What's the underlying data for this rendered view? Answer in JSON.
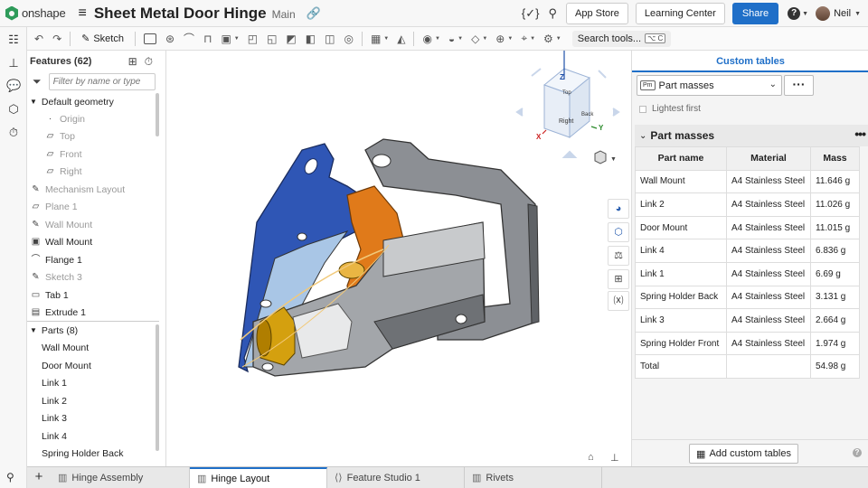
{
  "app": {
    "logo": "onshape",
    "doc_title": "Sheet Metal Door Hinge",
    "branch": "Main",
    "app_store": "App Store",
    "learning_center": "Learning Center",
    "share": "Share",
    "help": "?",
    "user": "Neil"
  },
  "toolbar": {
    "sketch": "Sketch",
    "search_tools": "Search tools...",
    "search_shortcut": "⌥ C"
  },
  "features": {
    "header": "Features (62)",
    "filter_placeholder": "Filter by name or type",
    "default_geometry": "Default geometry",
    "origin": "Origin",
    "top": "Top",
    "front": "Front",
    "right": "Right",
    "items": [
      {
        "label": "Mechanism Layout"
      },
      {
        "label": "Plane 1"
      },
      {
        "label": "Wall Mount"
      },
      {
        "label": "Wall Mount"
      },
      {
        "label": "Flange 1"
      },
      {
        "label": "Sketch 3"
      },
      {
        "label": "Tab 1"
      },
      {
        "label": "Extrude 1"
      }
    ],
    "parts_header": "Parts (8)",
    "parts": [
      "Wall Mount",
      "Door Mount",
      "Link 1",
      "Link 2",
      "Link 3",
      "Link 4",
      "Spring Holder Back"
    ]
  },
  "viewcube": {
    "top": "Top",
    "right": "Right",
    "back": "Back",
    "x": "X",
    "y": "Y",
    "z": "Z"
  },
  "custom_tables": {
    "title": "Custom tables",
    "selected_table": "Part masses",
    "badge": "Pm",
    "lightest_first": "Lightest first",
    "section_title": "Part masses",
    "columns": [
      "Part name",
      "Material",
      "Mass"
    ],
    "rows": [
      {
        "name": "Wall Mount",
        "material": "A4 Stainless Steel",
        "mass": "11.646 g"
      },
      {
        "name": "Link 2",
        "material": "A4 Stainless Steel",
        "mass": "11.026 g"
      },
      {
        "name": "Door Mount",
        "material": "A4 Stainless Steel",
        "mass": "11.015 g"
      },
      {
        "name": "Link 4",
        "material": "A4 Stainless Steel",
        "mass": "6.836 g"
      },
      {
        "name": "Link 1",
        "material": "A4 Stainless Steel",
        "mass": "6.69 g"
      },
      {
        "name": "Spring Holder Back",
        "material": "A4 Stainless Steel",
        "mass": "3.131 g"
      },
      {
        "name": "Link 3",
        "material": "A4 Stainless Steel",
        "mass": "2.664 g"
      },
      {
        "name": "Spring Holder Front",
        "material": "A4 Stainless Steel",
        "mass": "1.974 g"
      }
    ],
    "total_label": "Total",
    "total_mass": "54.98 g",
    "add_button": "Add custom tables"
  },
  "tabs": [
    {
      "label": "Hinge Assembly"
    },
    {
      "label": "Hinge Layout"
    },
    {
      "label": "Feature Studio 1"
    },
    {
      "label": "Rivets"
    }
  ],
  "colors": {
    "accent": "#1f6fc8",
    "part_blue": "#2f56b5",
    "part_orange": "#e07a1a",
    "part_grey": "#8c8f94",
    "part_gold": "#d4a00f"
  }
}
